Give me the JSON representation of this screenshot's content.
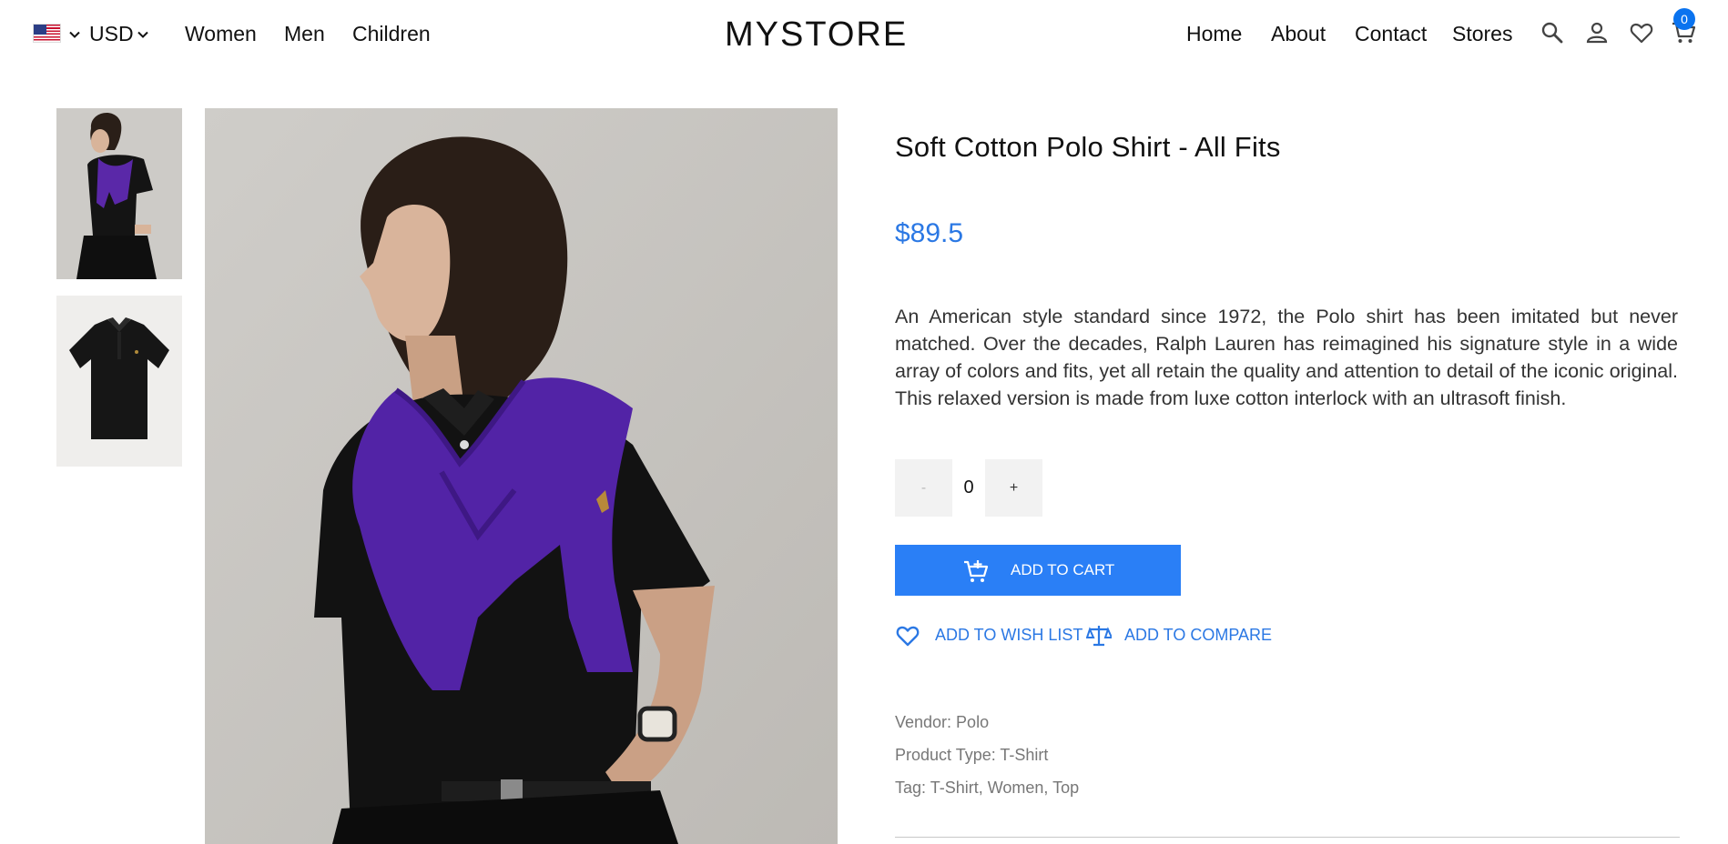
{
  "header": {
    "currency": "USD",
    "nav_left": [
      "Women",
      "Men",
      "Children"
    ],
    "logo": "MYSTORE",
    "nav_right": [
      "Home",
      "About",
      "Contact",
      "Stores"
    ],
    "cart_count": "0",
    "icons": [
      "us-flag-icon",
      "chevron-down-icon",
      "search-icon",
      "user-icon",
      "heart-icon",
      "cart-icon"
    ]
  },
  "product": {
    "title": "Soft Cotton Polo Shirt - All Fits",
    "price": "$89.5",
    "description": "An American style standard since 1972, the Polo shirt has been imitated but never matched. Over the decades, Ralph Lauren has reimagined his signature style in a wide array of colors and fits, yet all retain the quality and attention to detail of the iconic original. This relaxed version is made from luxe cotton interlock with an ultrasoft finish.",
    "quantity": {
      "minus": "-",
      "value": "0",
      "plus": "+"
    },
    "add_to_cart": "ADD TO CART",
    "add_to_wishlist": "ADD TO WISH LIST",
    "add_to_compare": "ADD TO COMPARE",
    "vendor": "Vendor: Polo",
    "product_type": "Product Type: T-Shirt",
    "tags": "Tag: T-Shirt, Women, Top"
  },
  "colors": {
    "accent": "#2a7ff6",
    "price": "#2b78e4",
    "badge": "#0a73ef"
  }
}
